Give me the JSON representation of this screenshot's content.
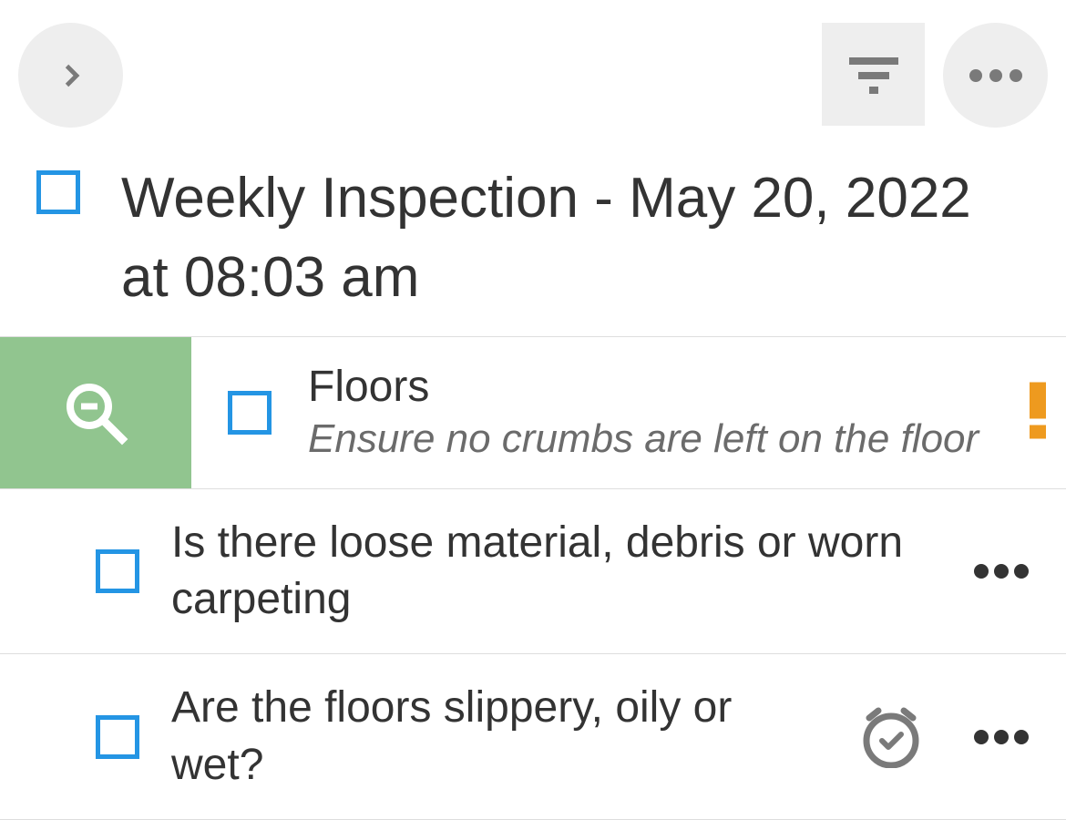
{
  "header": {
    "title": "Weekly Inspection - May 20, 2022 at 08:03 am"
  },
  "section": {
    "title": "Floors",
    "subtitle": "Ensure no crumbs are left on the floor"
  },
  "items": [
    {
      "text": "Is there loose material, debris or worn carpeting",
      "has_alarm": false
    },
    {
      "text": "Are the floors slippery, oily or wet?",
      "has_alarm": true
    }
  ]
}
